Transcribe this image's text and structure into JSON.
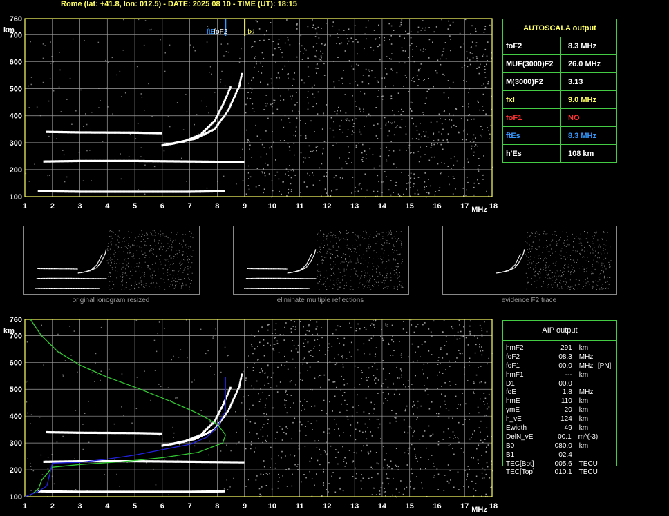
{
  "header": "Rome (lat: +41.8, lon: 012.5) - DATE: 2025 08 10 - TIME (UT): 18:15",
  "colors": {
    "grid": "#a0a0a0",
    "frame": "#ffff66",
    "ftEs": "#3399ff",
    "fxI": "#ffff66",
    "model": "#33cc33",
    "profile": "#2222dd"
  },
  "autoscala": {
    "title": "AUTOSCALA output",
    "rows": [
      {
        "key": "foF2",
        "value": "8.3 MHz",
        "color": "#ffffff"
      },
      {
        "key": "MUF(3000)F2",
        "value": "26.0 MHz",
        "color": "#ffffff"
      },
      {
        "key": "M(3000)F2",
        "value": "3.13",
        "color": "#ffffff"
      },
      {
        "key": "fxI",
        "value": "9.0 MHz",
        "color": "#ffff66"
      },
      {
        "key": "foF1",
        "value": "NO",
        "color": "#ff3333"
      },
      {
        "key": "ftEs",
        "value": "8.3 MHz",
        "color": "#3399ff"
      },
      {
        "key": "h'Es",
        "value": "108    km",
        "color": "#ffffff"
      }
    ]
  },
  "markers": {
    "ftEs_label": "ftEs",
    "foF2_label": "foF2",
    "fxI_label": "fxI",
    "ftEs": 8.3,
    "fxI": 9.0
  },
  "thumbnails": [
    {
      "caption": "original ionogram resized"
    },
    {
      "caption": "eliminate multiple reflections"
    },
    {
      "caption": "evidence F2 trace"
    }
  ],
  "aip": {
    "title": "AIP output",
    "rows": [
      [
        "hmF2",
        "291",
        "km",
        ""
      ],
      [
        "foF2",
        "08.3",
        "MHz",
        ""
      ],
      [
        "foF1",
        "00.0",
        "MHz",
        "[PN]"
      ],
      [
        "hmF1",
        "---",
        "km",
        ""
      ],
      [
        "D1",
        "00.0",
        "",
        ""
      ],
      [
        "foE",
        "1.8",
        "MHz",
        ""
      ],
      [
        "hmE",
        "110",
        "km",
        ""
      ],
      [
        "ymE",
        "20",
        "km",
        ""
      ],
      [
        "h_vE",
        "124",
        "km",
        ""
      ],
      [
        "Ewidth",
        "49",
        "km",
        ""
      ],
      [
        "DelN_vE",
        "00.1",
        "m^(-3)",
        ""
      ],
      [
        "B0",
        "080.0",
        "km",
        ""
      ],
      [
        "B1",
        "02.4",
        "",
        ""
      ],
      [
        "TEC[Bot]",
        "005.6",
        "TECU",
        ""
      ],
      [
        "TEC[Top]",
        "010.1",
        "TECU",
        ""
      ]
    ]
  },
  "chart_data": [
    {
      "type": "scatter",
      "title": "",
      "xlabel": "MHz",
      "ylabel": "km",
      "xlim": [
        1,
        18
      ],
      "ylim": [
        100,
        760
      ],
      "x_ticks": [
        "1",
        "2",
        "3",
        "4",
        "5",
        "6",
        "7",
        "8",
        "9",
        "10",
        "11",
        "12",
        "13",
        "14",
        "15",
        "16",
        "17",
        "18"
      ],
      "y_ticks": [
        "100",
        "200",
        "300",
        "400",
        "500",
        "600",
        "700",
        "760"
      ],
      "grid": true,
      "series": [
        {
          "points": [
            [
              1.5,
              120
            ],
            [
              3,
              118
            ],
            [
              5,
              118
            ],
            [
              7,
              118
            ],
            [
              8.3,
              120
            ]
          ]
        },
        {
          "points": [
            [
              1.7,
              230
            ],
            [
              3,
              232
            ],
            [
              5,
              232
            ],
            [
              7,
              230
            ],
            [
              9,
              228
            ]
          ]
        },
        {
          "points": [
            [
              1.8,
              340
            ],
            [
              3,
              338
            ],
            [
              5,
              337
            ],
            [
              6,
              335
            ]
          ]
        },
        {
          "points": [
            [
              6,
              290
            ],
            [
              6.8,
              305
            ],
            [
              7.4,
              330
            ],
            [
              7.9,
              380
            ],
            [
              8.2,
              440
            ],
            [
              8.5,
              510
            ]
          ]
        },
        {
          "points": [
            [
              6.3,
              295
            ],
            [
              7.2,
              315
            ],
            [
              7.9,
              350
            ],
            [
              8.4,
              420
            ],
            [
              8.8,
              510
            ],
            [
              8.9,
              560
            ]
          ]
        }
      ]
    },
    {
      "type": "line",
      "xlabel": "MHz",
      "ylabel": "km",
      "xlim": [
        1,
        18
      ],
      "ylim": [
        100,
        760
      ],
      "x_ticks": [
        "1",
        "2",
        "3",
        "4",
        "5",
        "6",
        "7",
        "8",
        "9",
        "10",
        "11",
        "12",
        "13",
        "14",
        "15",
        "16",
        "17",
        "18"
      ],
      "y_ticks": [
        "100",
        "200",
        "300",
        "400",
        "500",
        "600",
        "700",
        "760"
      ],
      "grid": true,
      "series": [
        {
          "points": [
            [
              1.2,
              760
            ],
            [
              1.6,
              700
            ],
            [
              2.2,
              640
            ],
            [
              3,
              590
            ],
            [
              4,
              545
            ],
            [
              5.2,
              500
            ],
            [
              6.3,
              455
            ],
            [
              7.3,
              410
            ],
            [
              8,
              370
            ],
            [
              8.3,
              330
            ],
            [
              8.2,
              300
            ],
            [
              7.3,
              265
            ],
            [
              6,
              245
            ],
            [
              4.5,
              230
            ],
            [
              3,
              220
            ],
            [
              2,
              210
            ],
            [
              1.6,
              160
            ],
            [
              1.5,
              130
            ],
            [
              1.2,
              105
            ]
          ]
        },
        {
          "points": [
            [
              1,
              100
            ],
            [
              1.5,
              120
            ],
            [
              1.8,
              140
            ],
            [
              2,
              225
            ],
            [
              3,
              228
            ],
            [
              4,
              240
            ],
            [
              5,
              255
            ],
            [
              6,
              275
            ],
            [
              7,
              295
            ],
            [
              7.6,
              320
            ],
            [
              8,
              360
            ],
            [
              8.3,
              420
            ],
            [
              8.3,
              545
            ]
          ]
        }
      ]
    }
  ]
}
